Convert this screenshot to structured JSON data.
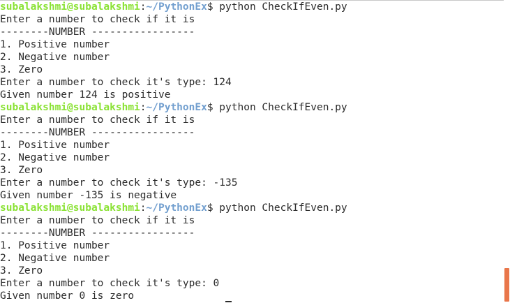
{
  "prompt": {
    "user_host": "subalakshmi@subalakshmi",
    "colon": ":",
    "path": "~/PythonEx",
    "sign": "$"
  },
  "lines": [
    {
      "type": "prompt",
      "command": " python CheckIfEven.py"
    },
    {
      "type": "out",
      "text": "Enter a number to check if it is"
    },
    {
      "type": "out",
      "text": "--------NUMBER -----------------"
    },
    {
      "type": "out",
      "text": "1. Positive number"
    },
    {
      "type": "out",
      "text": "2. Negative number"
    },
    {
      "type": "out",
      "text": "3. Zero"
    },
    {
      "type": "out",
      "text": "Enter a number to check it's type: 124"
    },
    {
      "type": "out",
      "text": "Given number 124 is positive"
    },
    {
      "type": "prompt",
      "command": " python CheckIfEven.py"
    },
    {
      "type": "out",
      "text": "Enter a number to check if it is"
    },
    {
      "type": "out",
      "text": "--------NUMBER -----------------"
    },
    {
      "type": "out",
      "text": "1. Positive number"
    },
    {
      "type": "out",
      "text": "2. Negative number"
    },
    {
      "type": "out",
      "text": "3. Zero"
    },
    {
      "type": "out",
      "text": "Enter a number to check it's type: -135"
    },
    {
      "type": "out",
      "text": "Given number -135 is negative"
    },
    {
      "type": "prompt",
      "command": " python CheckIfEven.py"
    },
    {
      "type": "out",
      "text": "Enter a number to check if it is"
    },
    {
      "type": "out",
      "text": "--------NUMBER -----------------"
    },
    {
      "type": "out",
      "text": "1. Positive number"
    },
    {
      "type": "out",
      "text": "2. Negative number"
    },
    {
      "type": "out",
      "text": "3. Zero"
    },
    {
      "type": "out",
      "text": "Enter a number to check it's type: 0"
    },
    {
      "type": "out",
      "text": "Given number 0 is zero"
    }
  ],
  "colors": {
    "background": "#ffffff",
    "text": "#2b2b2b",
    "user_host": "#8ae234",
    "path": "#729fcf",
    "scrollbar_thumb": "#e9764a"
  }
}
